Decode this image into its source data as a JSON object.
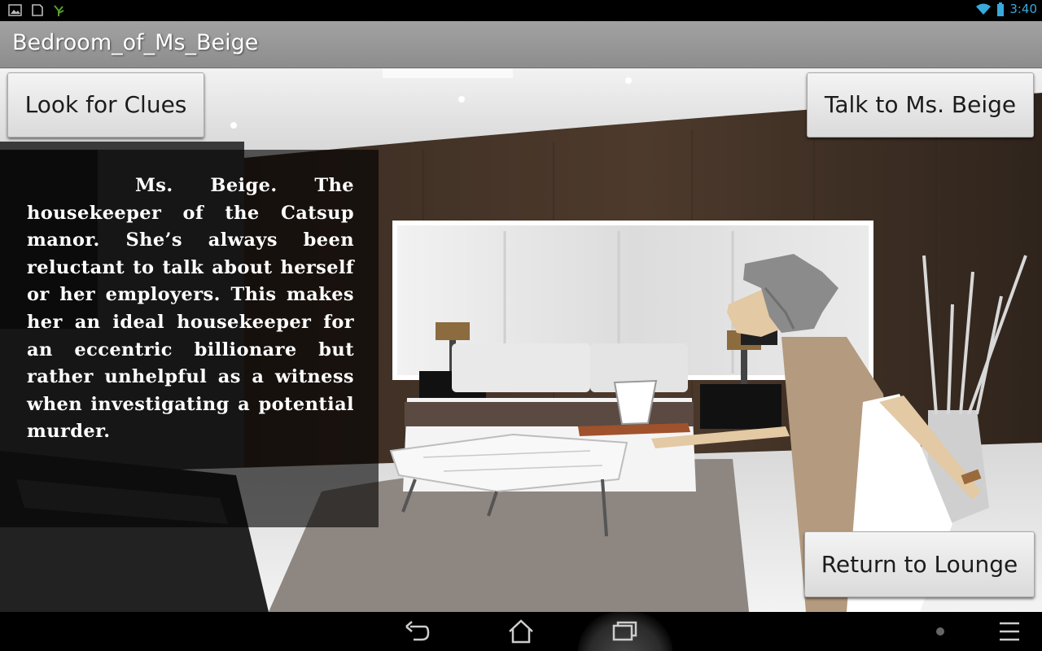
{
  "status_bar": {
    "time": "3:40",
    "icons": [
      "picture-icon",
      "shield-icon",
      "leaf-icon",
      "wifi-icon",
      "battery-icon"
    ],
    "accent_color": "#39a9dc"
  },
  "action_bar": {
    "title": "Bedroom_of_Ms_Beige"
  },
  "buttons": {
    "look_for_clues": "Look for Clues",
    "talk_to": "Talk to Ms. Beige",
    "return": "Return to Lounge"
  },
  "description": {
    "text": "Ms. Beige. The housekeeper of the Catsup manor. She’s always been reluctant to talk about herself or her employers. This makes her an ideal housekeeper for an eccentric billionare but rather unhelpful as a witness when investigating a potential murder."
  },
  "nav_bar": {
    "icons": [
      "back-icon",
      "home-icon",
      "recent-apps-icon",
      "menu-icon"
    ]
  }
}
